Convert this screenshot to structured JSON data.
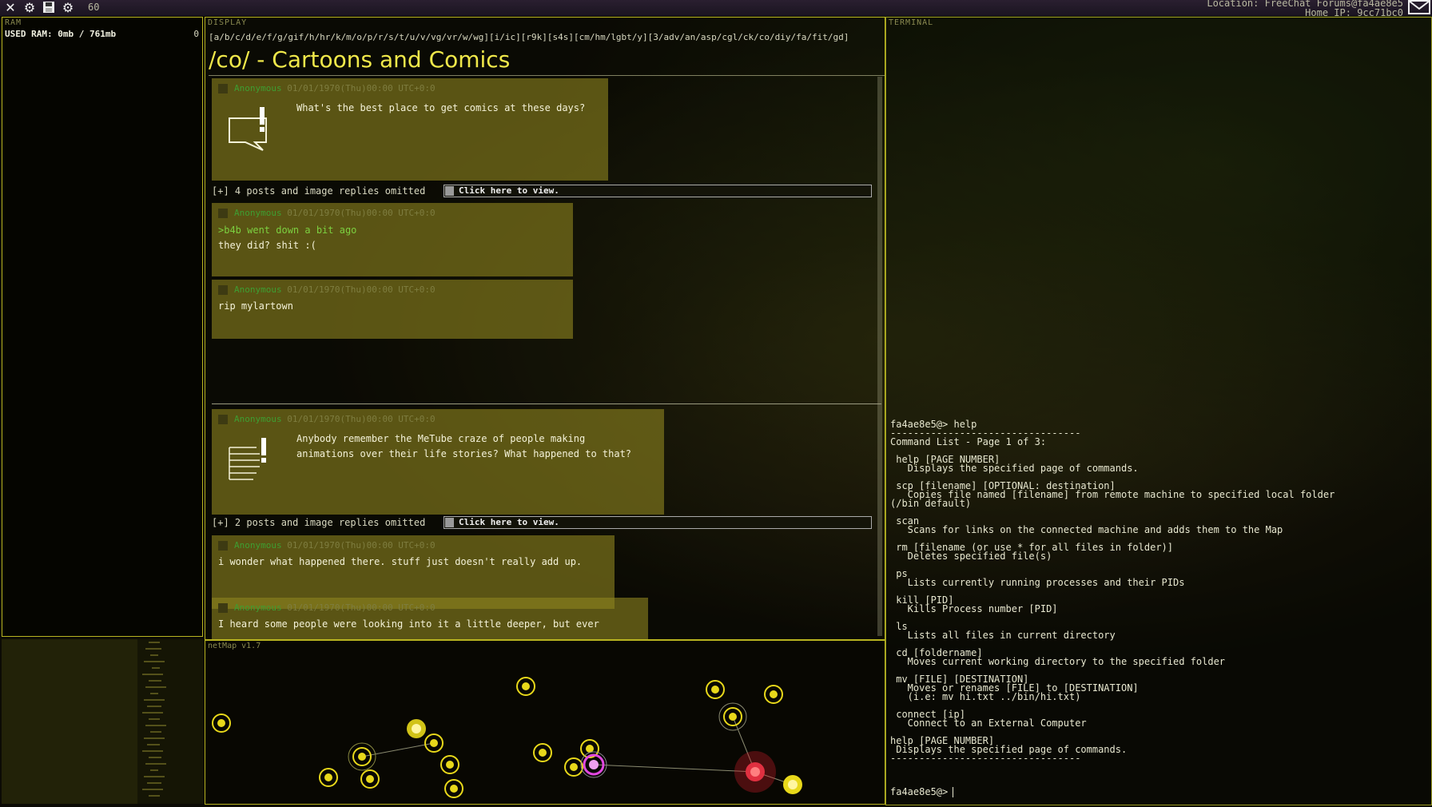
{
  "topbar": {
    "icons": [
      "close-icon",
      "gear-icon",
      "save-icon",
      "settings-icon"
    ],
    "fps": "60",
    "location_line1": "Location: FreeChat Forums@fa4ae8e5",
    "location_line2": "Home IP: 9cc71bc0"
  },
  "ram": {
    "label": "RAM",
    "used": "USED RAM: 0mb / 761mb",
    "count": "0"
  },
  "display": {
    "label": "DISPLAY",
    "boards": "[a/b/c/d/e/f/g/gif/h/hr/k/m/o/p/r/s/t/u/v/vg/vr/w/wg][i/ic][r9k][s4s][cm/hm/lgbt/y][3/adv/an/asp/cgl/ck/co/diy/fa/fit/gd]",
    "title": "/co/ - Cartoons and Comics",
    "threads": [
      {
        "op": {
          "name": "Anonymous",
          "date": "01/01/1970(Thu)00:00 UTC+0:0",
          "text": "What's the best place to get comics at these days?"
        },
        "omitted": "[+] 4 posts and image replies omitted",
        "view_label": "Click here to view.",
        "replies": [
          {
            "name": "Anonymous",
            "date": "01/01/1970(Thu)00:00 UTC+0:0",
            "greentext": ">b4b went down a bit ago",
            "text": "they did? shit :("
          },
          {
            "name": "Anonymous",
            "date": "01/01/1970(Thu)00:00 UTC+0:0",
            "greentext": "",
            "text": "rip mylartown"
          }
        ]
      },
      {
        "op": {
          "name": "Anonymous",
          "date": "01/01/1970(Thu)00:00 UTC+0:0",
          "text1": "Anybody remember the MeTube craze of people making",
          "text2": "animations over their life stories? What happened to that?"
        },
        "omitted": "[+] 2 posts and image replies omitted",
        "view_label": "Click here to view.",
        "replies": [
          {
            "name": "Anonymous",
            "date": "01/01/1970(Thu)00:00 UTC+0:0",
            "text": "i wonder what happened there. stuff just doesn't really add up."
          },
          {
            "name": "Anonymous",
            "date": "01/01/1970(Thu)00:00 UTC+0:0",
            "text": "I heard some people were looking into it a little deeper, but ever"
          }
        ]
      }
    ]
  },
  "netmap": {
    "label": "netMap v1.7"
  },
  "terminal": {
    "label": "TERMINAL",
    "prompt": "fa4ae8e5@>",
    "lines": [
      "fa4ae8e5@> help",
      "---------------------------------",
      "Command List - Page 1 of 3:",
      "",
      " help [PAGE NUMBER]",
      "   Displays the specified page of commands.",
      "",
      " scp [filename] [OPTIONAL: destination]",
      "   Copies file named [filename] from remote machine to specified local folder",
      "(/bin default)",
      "",
      " scan",
      "   Scans for links on the connected machine and adds them to the Map",
      "",
      " rm [filename (or use * for all files in folder)]",
      "   Deletes specified file(s)",
      "",
      " ps",
      "   Lists currently running processes and their PIDs",
      "",
      " kill [PID]",
      "   Kills Process number [PID]",
      "",
      " ls",
      "   Lists all files in current directory",
      "",
      " cd [foldername]",
      "   Moves current working directory to the specified folder",
      "",
      " mv [FILE] [DESTINATION]",
      "   Moves or renames [FILE] to [DESTINATION]",
      "   (i.e: mv hi.txt ../bin/hi.txt)",
      "",
      " connect [ip]",
      "   Connect to an External Computer",
      "",
      "help [PAGE NUMBER]",
      " Displays the specified page of commands.",
      "---------------------------------",
      ""
    ]
  },
  "colors": {
    "accent": "#b8b420",
    "post_bg": "#8c821e",
    "title": "#f0e84a",
    "node": "#e8d81a",
    "node_player": "#e048e0",
    "node_target": "#e03040"
  }
}
